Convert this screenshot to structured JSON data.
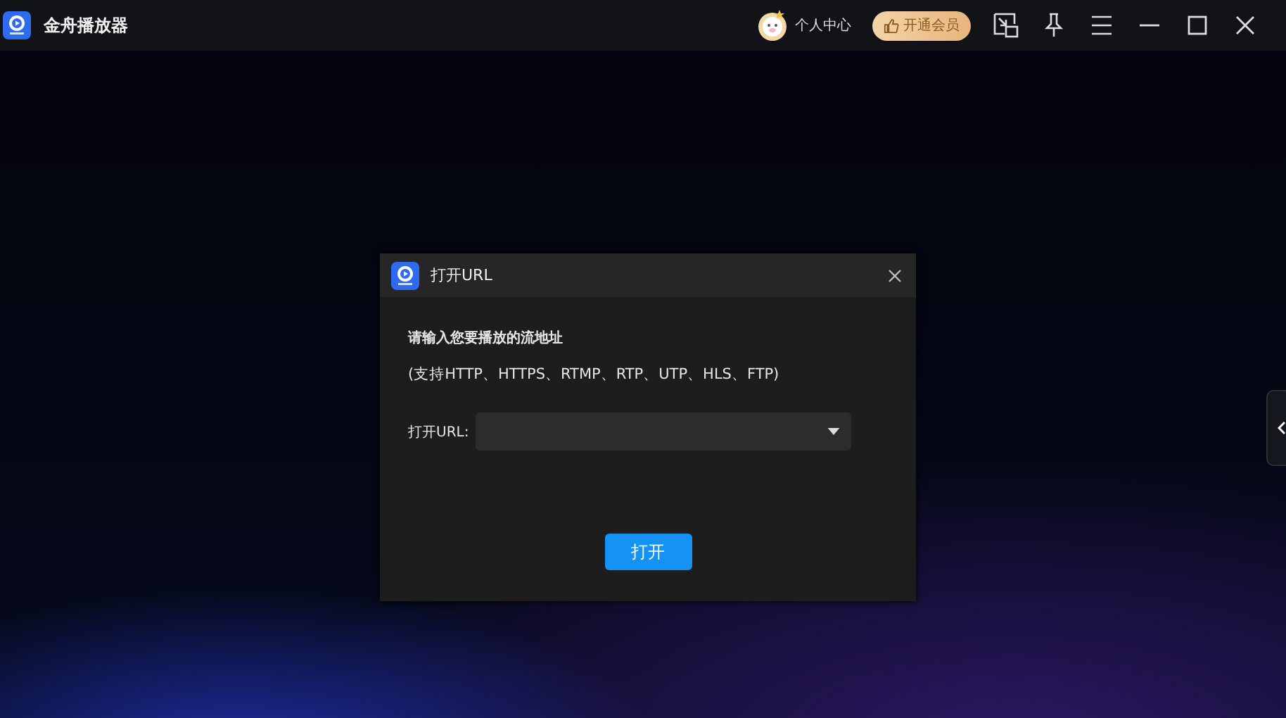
{
  "window": {
    "title": "金舟播放器"
  },
  "titlebar": {
    "user_label": "个人中心",
    "vip_button": "开通会员"
  },
  "dialog": {
    "title": "打开URL",
    "prompt": "请输入您要播放的流地址",
    "protocols": "(支持HTTP、HTTPS、RTMP、RTP、UTP、HLS、FTP)",
    "url_label": "打开URL:",
    "open_button": "打开"
  }
}
